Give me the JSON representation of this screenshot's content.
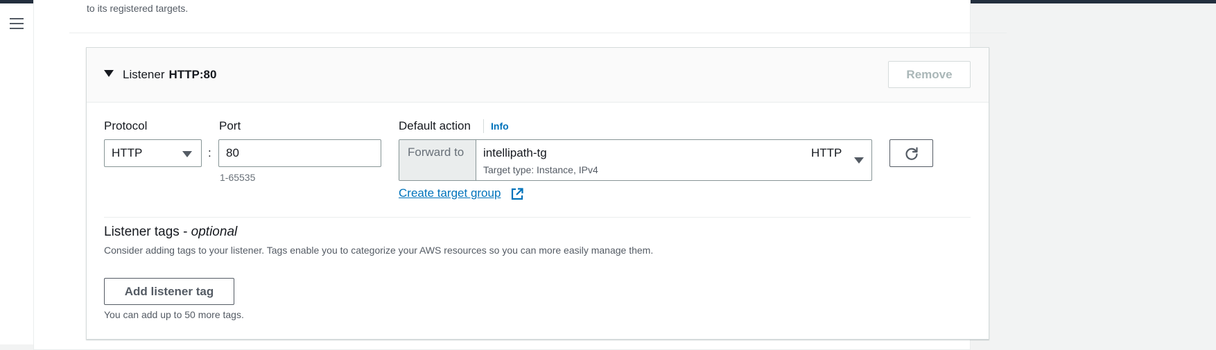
{
  "nav": {
    "menu_icon": "hamburger-menu-icon"
  },
  "intro": {
    "text": "to its registered targets."
  },
  "listener": {
    "title_prefix": "Listener",
    "title_value": "HTTP:80",
    "remove_label": "Remove",
    "protocol_label": "Protocol",
    "protocol_value": "HTTP",
    "separator": ":",
    "port_label": "Port",
    "port_value": "80",
    "port_hint": "1-65535",
    "default_action_label": "Default action",
    "info_label": "Info",
    "forward_prefix": "Forward to",
    "target_group_name": "intellipath-tg",
    "target_group_protocol": "HTTP",
    "target_type": "Target type: Instance, IPv4",
    "create_target_group_label": "Create target group",
    "refresh_icon": "refresh-icon",
    "external_link_icon": "external-link-icon"
  },
  "tags": {
    "heading": "Listener tags - ",
    "heading_optional": "optional",
    "description": "Consider adding tags to your listener. Tags enable you to categorize your AWS resources so you can more easily manage them.",
    "add_label": "Add listener tag",
    "limit_text": "You can add up to 50 more tags."
  },
  "colors": {
    "link": "#0073bb",
    "header_bar": "#232f3e",
    "border": "#879596",
    "disabled_text": "#aab7b8"
  }
}
